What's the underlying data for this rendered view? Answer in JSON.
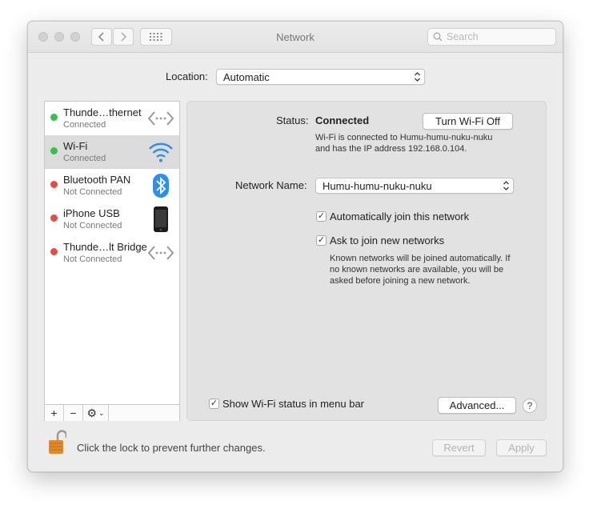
{
  "window": {
    "title": "Network"
  },
  "toolbar": {
    "search_placeholder": "Search"
  },
  "location": {
    "label": "Location:",
    "value": "Automatic"
  },
  "services": [
    {
      "name": "Thunde…thernet",
      "status": "Connected",
      "connected": true,
      "icon": "ethernet-arrows-icon"
    },
    {
      "name": "Wi-Fi",
      "status": "Connected",
      "connected": true,
      "icon": "wifi-icon",
      "selected": true
    },
    {
      "name": "Bluetooth PAN",
      "status": "Not Connected",
      "connected": false,
      "icon": "bluetooth-icon"
    },
    {
      "name": "iPhone USB",
      "status": "Not Connected",
      "connected": false,
      "icon": "iphone-icon"
    },
    {
      "name": "Thunde…lt Bridge",
      "status": "Not Connected",
      "connected": false,
      "icon": "ethernet-arrows-icon"
    }
  ],
  "sidebar_controls": {
    "add": "+",
    "remove": "−",
    "action": "⚙"
  },
  "detail": {
    "status_label": "Status:",
    "status_value": "Connected",
    "turn_off_button": "Turn Wi-Fi Off",
    "status_desc_line1": "Wi-Fi is connected to Humu-humu-nuku-nuku",
    "status_desc_line2": "and has the IP address 192.168.0.104.",
    "network_name_label": "Network Name:",
    "network_name_value": "Humu-humu-nuku-nuku",
    "auto_join_label": "Automatically join this network",
    "auto_join_checked": true,
    "ask_join_label": "Ask to join new networks",
    "ask_join_checked": true,
    "ask_desc_line1": "Known networks will be joined automatically. If",
    "ask_desc_line2": "no known networks are available, you will be",
    "ask_desc_line3": "asked before joining a new network.",
    "show_status_label": "Show Wi-Fi status in menu bar",
    "show_status_checked": true,
    "advanced_button": "Advanced...",
    "help_button": "?"
  },
  "footer": {
    "lock_text": "Click the lock to prevent further changes.",
    "revert_button": "Revert",
    "apply_button": "Apply"
  },
  "colors": {
    "connected": "#35c24a",
    "not_connected": "#e84a44",
    "wifi_blue": "#2f8fe8",
    "bluetooth_blue": "#2a8ff0",
    "lock_orange": "#e08a2a"
  }
}
